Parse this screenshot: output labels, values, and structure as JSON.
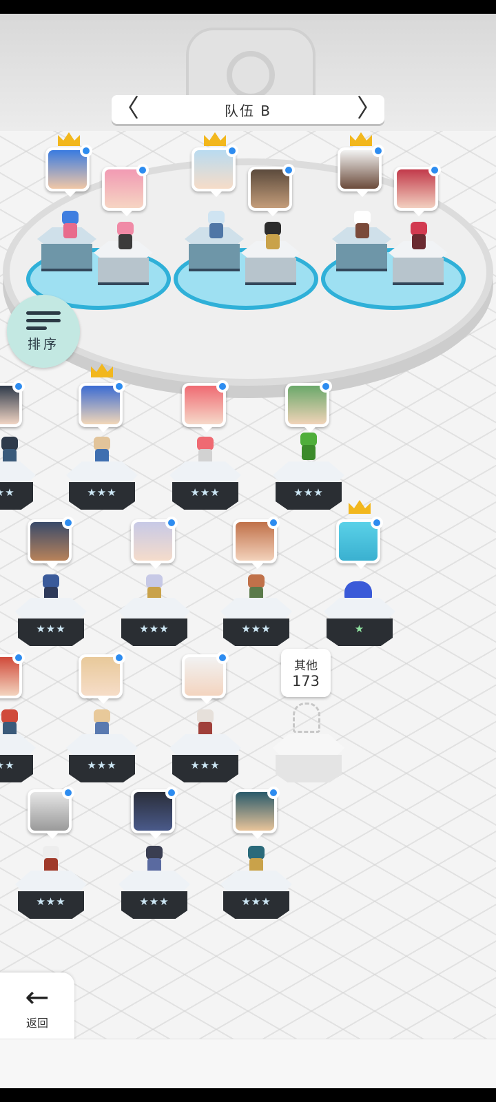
{
  "team": {
    "title": "队伍 B",
    "prev_label": "〈",
    "next_label": "〉"
  },
  "sort_button": {
    "label": "排序"
  },
  "back_button": {
    "label": "返回",
    "icon": "←"
  },
  "others": {
    "label": "其他",
    "count": "173"
  },
  "roster": {
    "row1": [
      {
        "name": "hero-r1-c0",
        "stars": "★★★"
      },
      {
        "name": "hero-r1-c1",
        "stars": "★★★",
        "crowned": true
      },
      {
        "name": "hero-r1-c2",
        "stars": "★★★"
      },
      {
        "name": "hero-r1-c3",
        "stars": "★★★"
      }
    ],
    "row2": [
      {
        "stars": "★★★"
      },
      {
        "stars": "★★★"
      },
      {
        "stars": "★★★"
      },
      {
        "stars": "★",
        "crowned": true
      }
    ],
    "row3": [
      {
        "stars": "★★★"
      },
      {
        "stars": "★★★"
      },
      {
        "stars": "★★★"
      }
    ],
    "row4": [
      {
        "stars": "★★★"
      },
      {
        "stars": "★★★"
      },
      {
        "stars": "★★★"
      }
    ]
  },
  "colors": {
    "accent_blue": "#2d8cf0",
    "crown_gold": "#f2b71d",
    "sort_bg": "#c3e8e2",
    "slot_glow": "#2fb0d8"
  },
  "icons": {
    "sort": "sort-lines-icon",
    "back": "back-arrow-icon",
    "crown": "crown-icon",
    "badge": "blue-dot-icon"
  }
}
